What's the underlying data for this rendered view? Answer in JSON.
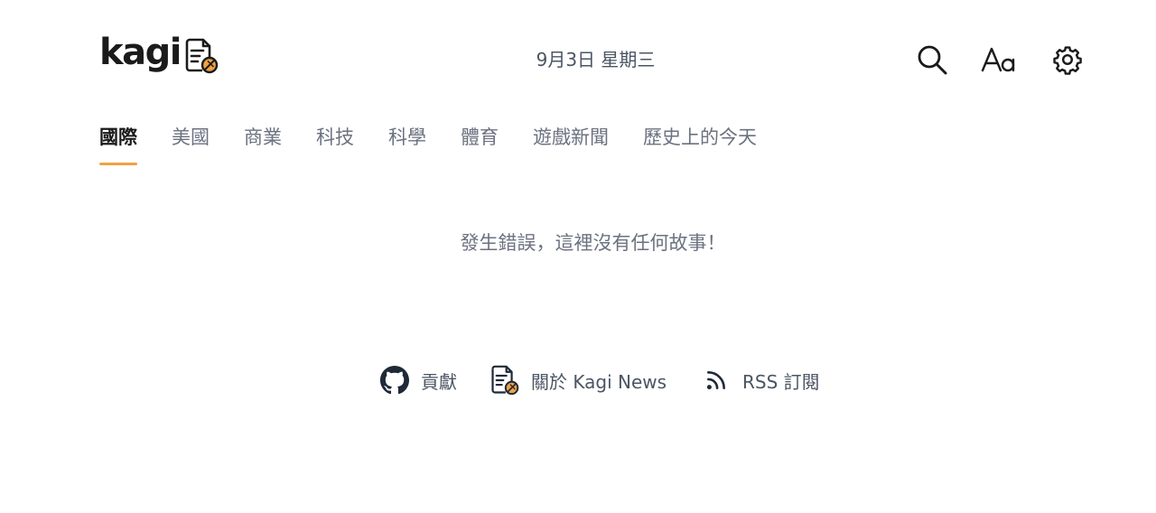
{
  "header": {
    "logo_text": "kagi",
    "date": "9月3日 星期三",
    "icons": [
      "search-icon",
      "font-size-icon",
      "gear-icon"
    ]
  },
  "tabs": [
    {
      "label": "國際",
      "active": true
    },
    {
      "label": "美國",
      "active": false
    },
    {
      "label": "商業",
      "active": false
    },
    {
      "label": "科技",
      "active": false
    },
    {
      "label": "科學",
      "active": false
    },
    {
      "label": "體育",
      "active": false
    },
    {
      "label": "遊戲新聞",
      "active": false
    },
    {
      "label": "歷史上的今天",
      "active": false
    }
  ],
  "main": {
    "error_message": "發生錯誤，這裡沒有任何故事！"
  },
  "footer": {
    "contribute_label": "貢獻",
    "about_label": "關於 Kagi News",
    "rss_label": "RSS 訂閱"
  },
  "colors": {
    "accent": "#f0a142",
    "text_primary": "#1a1a1a",
    "text_muted": "#6b7280"
  }
}
